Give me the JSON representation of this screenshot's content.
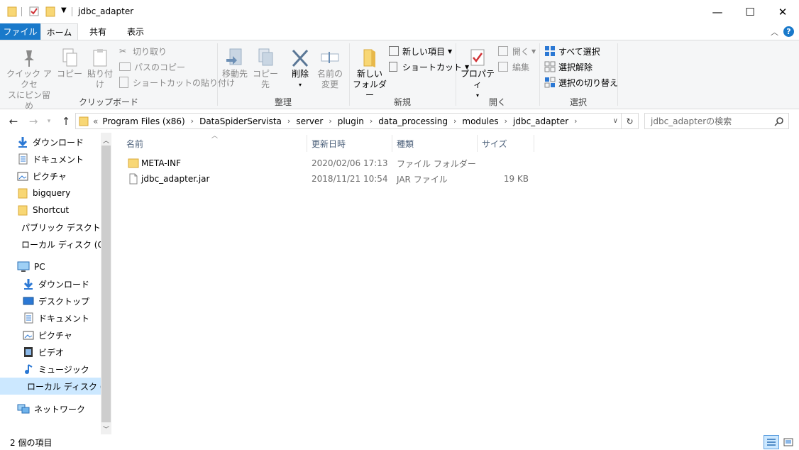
{
  "window": {
    "title": "jdbc_adapter",
    "buttons": {
      "minimize": "—",
      "maximize": "☐",
      "close": "✕"
    }
  },
  "tabs": {
    "file": "ファイル",
    "home": "ホーム",
    "share": "共有",
    "view": "表示"
  },
  "ribbon": {
    "clipboard": {
      "label": "クリップボード",
      "pin": [
        "クイック アクセ",
        "スにピン留め"
      ],
      "copy": "コピー",
      "paste": "貼り付け",
      "cut": "切り取り",
      "copy_path": "パスのコピー",
      "paste_shortcut": "ショートカットの貼り付け"
    },
    "organize": {
      "label": "整理",
      "move_to": "移動先",
      "copy_to": "コピー先",
      "delete": "削除",
      "rename": [
        "名前の",
        "変更"
      ]
    },
    "new": {
      "label": "新規",
      "new_item": "新しい項目",
      "shortcut": "ショートカット",
      "new_folder": [
        "新しい",
        "フォルダー"
      ]
    },
    "open": {
      "label": "開く",
      "properties": "プロパティ",
      "open": "開く",
      "edit": "編集"
    },
    "select": {
      "label": "選択",
      "select_all": "すべて選択",
      "select_none": "選択解除",
      "invert": "選択の切り替え"
    }
  },
  "address": {
    "prefix": "«",
    "crumbs": [
      "Program Files (x86)",
      "DataSpiderServista",
      "server",
      "plugin",
      "data_processing",
      "modules",
      "jdbc_adapter"
    ],
    "search_placeholder": "jdbc_adapterの検索"
  },
  "nav": {
    "quick": [
      {
        "label": "ダウンロード",
        "icon": "download-icon",
        "pinned": true
      },
      {
        "label": "ドキュメント",
        "icon": "document-icon",
        "pinned": true
      },
      {
        "label": "ピクチャ",
        "icon": "picture-icon",
        "pinned": true
      },
      {
        "label": "bigquery",
        "icon": "folder-icon",
        "pinned": false
      },
      {
        "label": "Shortcut",
        "icon": "folder-icon",
        "pinned": false
      },
      {
        "label": "パブリック デスクトップ",
        "icon": "folder-icon",
        "pinned": false
      },
      {
        "label": "ローカル ディスク (C:)",
        "icon": "drive-icon",
        "pinned": false
      }
    ],
    "pc_label": "PC",
    "pc": [
      {
        "label": "ダウンロード",
        "icon": "download-icon"
      },
      {
        "label": "デスクトップ",
        "icon": "desktop-icon"
      },
      {
        "label": "ドキュメント",
        "icon": "document-icon"
      },
      {
        "label": "ピクチャ",
        "icon": "picture-icon"
      },
      {
        "label": "ビデオ",
        "icon": "video-icon"
      },
      {
        "label": "ミュージック",
        "icon": "music-icon"
      },
      {
        "label": "ローカル ディスク (C:)",
        "icon": "drive-icon"
      }
    ],
    "network_label": "ネットワーク"
  },
  "columns": {
    "name": "名前",
    "modified": "更新日時",
    "type": "種類",
    "size": "サイズ"
  },
  "files": [
    {
      "name": "META-INF",
      "modified": "2020/02/06 17:13",
      "type": "ファイル フォルダー",
      "size": "",
      "icon": "folder-icon"
    },
    {
      "name": "jdbc_adapter.jar",
      "modified": "2018/11/21 10:54",
      "type": "JAR ファイル",
      "size": "19 KB",
      "icon": "file-icon"
    }
  ],
  "status": {
    "count": "2 個の項目"
  },
  "colors": {
    "accent": "#1979ca",
    "selected": "#cce8ff",
    "folder": "#f8d775"
  }
}
